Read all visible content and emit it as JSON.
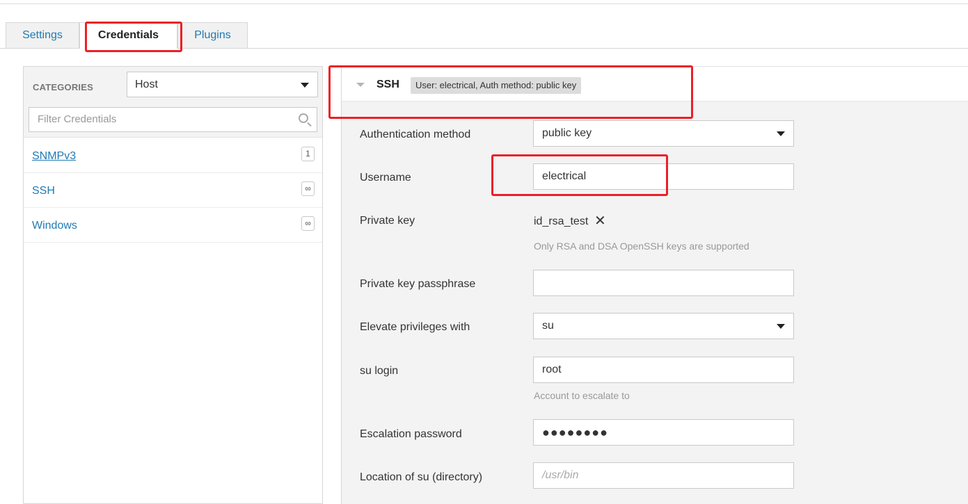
{
  "tabs": [
    {
      "label": "Settings",
      "active": false
    },
    {
      "label": "Credentials",
      "active": true
    },
    {
      "label": "Plugins",
      "active": false
    }
  ],
  "categories": {
    "label": "CATEGORIES",
    "selected": "Host",
    "filter_placeholder": "Filter Credentials",
    "items": [
      {
        "label": "SNMPv3",
        "badge": "1"
      },
      {
        "label": "SSH",
        "badge": "∞"
      },
      {
        "label": "Windows",
        "badge": "∞"
      }
    ]
  },
  "ssh": {
    "title": "SSH",
    "summary": "User: electrical, Auth method: public key",
    "fields": {
      "auth_method": {
        "label": "Authentication method",
        "value": "public key"
      },
      "username": {
        "label": "Username",
        "value": "electrical"
      },
      "private_key": {
        "label": "Private key",
        "value": "id_rsa_test",
        "help": "Only RSA and DSA OpenSSH keys are supported"
      },
      "passphrase": {
        "label": "Private key passphrase",
        "value": ""
      },
      "elevate": {
        "label": "Elevate privileges with",
        "value": "su"
      },
      "su_login": {
        "label": "su login",
        "value": "root",
        "help": "Account to escalate to"
      },
      "escalation_password": {
        "label": "Escalation password",
        "value": "●●●●●●●●"
      },
      "su_location": {
        "label": "Location of su (directory)",
        "placeholder": "/usr/bin"
      }
    }
  },
  "colors": {
    "highlight": "#ec2027",
    "link": "#1f7ab3"
  }
}
